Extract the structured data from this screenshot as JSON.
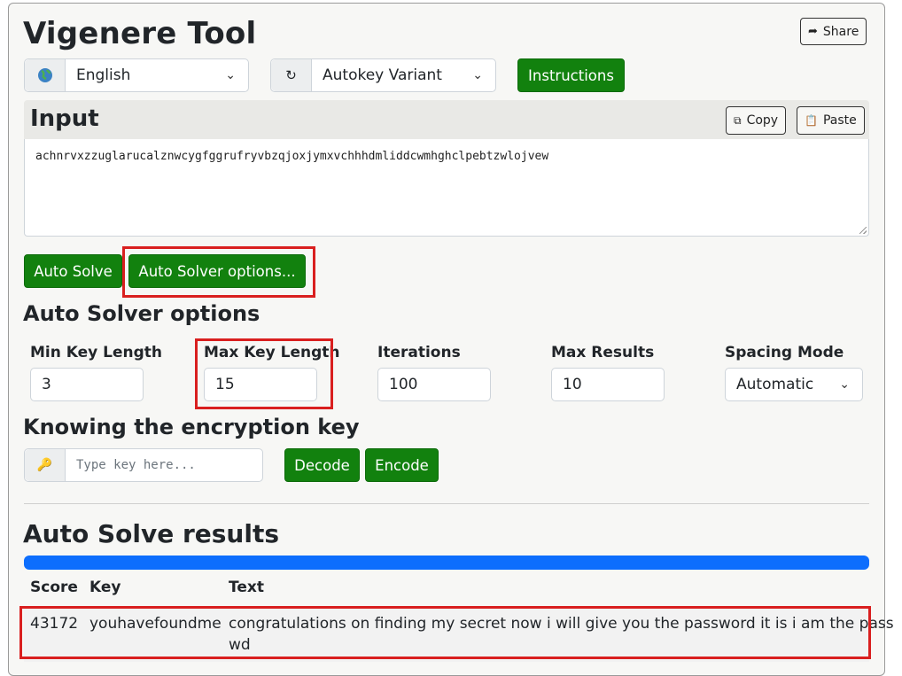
{
  "app": {
    "title": "Vigenere Tool",
    "share_label": "Share",
    "share_icon": "share-arrow-icon"
  },
  "toolbar": {
    "language": {
      "icon": "globe-icon",
      "value": "English"
    },
    "variant": {
      "icon": "cycle-arrow-icon",
      "value": "Autokey Variant"
    },
    "instructions_label": "Instructions"
  },
  "input": {
    "heading": "Input",
    "copy_label": "Copy",
    "paste_label": "Paste",
    "text": "achnrvxzzuglarucalznwcygfggrufryvbzqjoxjymxvchhhdmliddcwmhghclpebtzwlojvew"
  },
  "actions": {
    "auto_solve_label": "Auto Solve",
    "auto_solver_options_label": "Auto Solver options..."
  },
  "auto_solver_options": {
    "heading": "Auto Solver options",
    "fields": [
      {
        "label": "Min Key Length",
        "value": "3"
      },
      {
        "label": "Max Key Length",
        "value": "15"
      },
      {
        "label": "Iterations",
        "value": "100"
      },
      {
        "label": "Max Results",
        "value": "10"
      },
      {
        "label": "Spacing Mode",
        "value": "Automatic"
      }
    ]
  },
  "known_key": {
    "heading": "Knowing the encryption key",
    "placeholder": "Type key here...",
    "decode_label": "Decode",
    "encode_label": "Encode"
  },
  "results": {
    "heading": "Auto Solve results",
    "progress": 1.0,
    "columns": [
      "Score",
      "Key",
      "Text"
    ],
    "rows": [
      {
        "score": "43172",
        "key": "youhavefoundme",
        "text_line1": "congratulations on finding my secret now i will give you the password it is i am the pass",
        "text_line2": "wd"
      }
    ]
  },
  "colors": {
    "green": "#12810e",
    "progress_blue": "#0d6efd",
    "highlight_red": "#d91f1f"
  }
}
